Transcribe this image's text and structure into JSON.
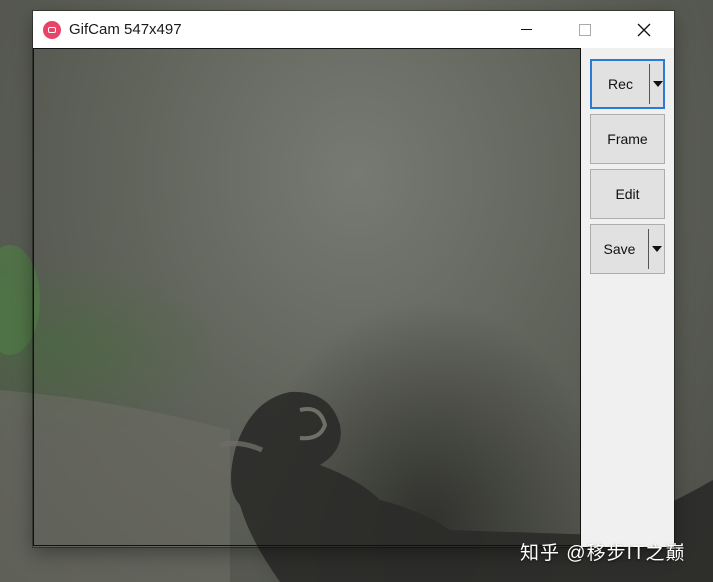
{
  "window": {
    "title": "GifCam 547x497",
    "app_icon": "camera-icon",
    "controls": [
      "minimize-icon",
      "maximize-icon",
      "close-icon"
    ]
  },
  "toolbar": {
    "rec_label": "Rec",
    "frame_label": "Frame",
    "edit_label": "Edit",
    "save_label": "Save"
  },
  "colors": {
    "focus_border": "#2a7bd6",
    "app_icon": "#e8446a",
    "panel_bg": "#f0f0f0",
    "button_bg": "#e1e1e1"
  },
  "watermark": "知乎 @移步IT之巅"
}
